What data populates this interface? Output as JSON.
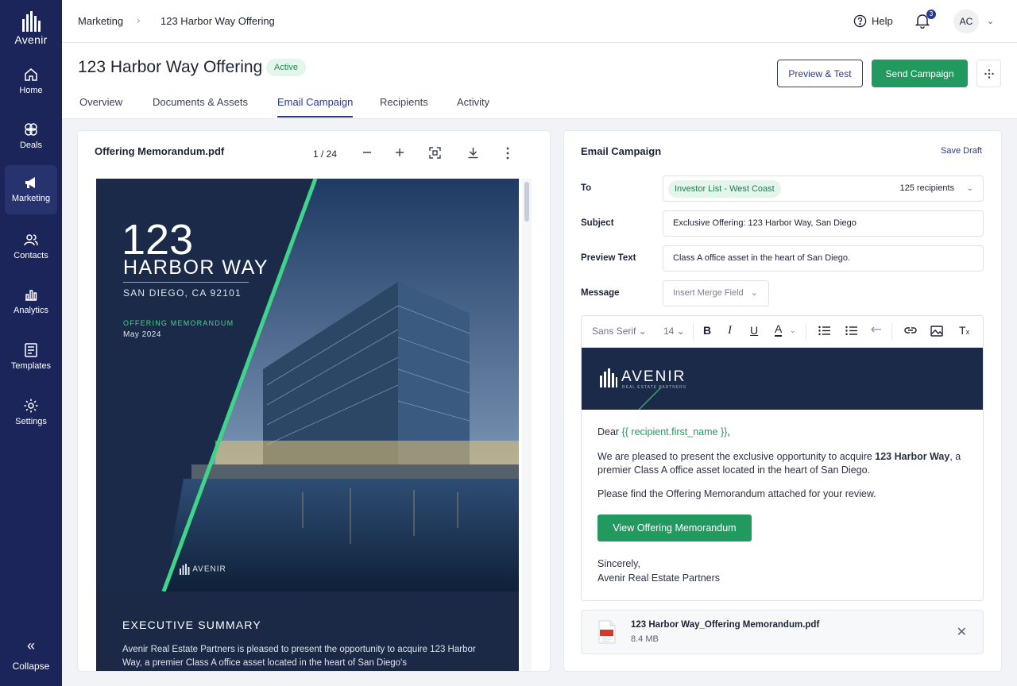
{
  "brand": {
    "name": "Avenir"
  },
  "sidebar": {
    "items": [
      {
        "label": "Home",
        "icon": "home-icon"
      },
      {
        "label": "Deals",
        "icon": "deals-icon"
      },
      {
        "label": "Marketing",
        "icon": "megaphone-icon",
        "active": true
      },
      {
        "label": "Contacts",
        "icon": "contacts-icon"
      },
      {
        "label": "Analytics",
        "icon": "analytics-icon"
      },
      {
        "label": "Templates",
        "icon": "templates-icon"
      },
      {
        "label": "Settings",
        "icon": "gear-icon"
      }
    ],
    "collapse_label": "Collapse"
  },
  "topbar": {
    "breadcrumb": [
      "Marketing",
      "123 Harbor Way Offering"
    ],
    "help_label": "Help",
    "notification_count": "3",
    "avatar_initials": "AC"
  },
  "header": {
    "title": "123 Harbor Way Offering",
    "status": "Active",
    "preview_label": "Preview & Test",
    "send_label": "Send Campaign",
    "tabs": [
      "Overview",
      "Documents & Assets",
      "Email Campaign",
      "Recipients",
      "Activity"
    ],
    "active_tab": "Email Campaign"
  },
  "pdf": {
    "filename": "Offering Memorandum.pdf",
    "page_indicator": "1 / 24",
    "cover": {
      "number": "123",
      "name": "HARBOR WAY",
      "city": "SAN DIEGO, CA 92101",
      "doc_type": "OFFERING MEMORANDUM",
      "date": "May 2024",
      "logo_text": "AVENIR"
    },
    "exec_title": "EXECUTIVE SUMMARY",
    "exec_text": "Avenir Real Estate Partners is pleased to present the opportunity to acquire 123 Harbor Way, a premier Class A office asset located in the heart of San Diego's"
  },
  "email": {
    "title": "Email Campaign",
    "save_draft": "Save Draft",
    "to_label": "To",
    "to_list": "Investor List - West Coast",
    "recipients": "125 recipients",
    "subject_label": "Subject",
    "subject_value": "Exclusive Offering: 123 Harbor Way, San Diego",
    "preview_label": "Preview Text",
    "preview_value": "Class A office asset in the heart of San Diego.",
    "message_label": "Message",
    "merge_field_label": "Insert Merge Field",
    "toolbar": {
      "font": "Sans Serif",
      "size": "14"
    },
    "banner": {
      "name": "AVENIR",
      "sub": "REAL ESTATE PARTNERS"
    },
    "body": {
      "greeting_prefix": "Dear ",
      "merge_field": "{{ recipient.first_name }}",
      "greeting_suffix": ",",
      "p1_prefix": "We are pleased to present the exclusive opportunity to acquire ",
      "p1_bold": "123 Harbor Way",
      "p1_suffix": ", a premier Class A office asset located in the heart of San Diego.",
      "p2": "Please find the Offering Memorandum attached for your review.",
      "cta": "View Offering Memorandum",
      "signoff": "Sincerely,",
      "signature": "Avenir Real Estate Partners"
    },
    "attachment": {
      "name": "123 Harbor Way_Offering Memorandum.pdf",
      "size": "8.4 MB"
    }
  },
  "colors": {
    "sidebar": "#1b2559",
    "accent": "#2b3a8a",
    "green": "#22995f",
    "navy": "#1a2a48"
  }
}
